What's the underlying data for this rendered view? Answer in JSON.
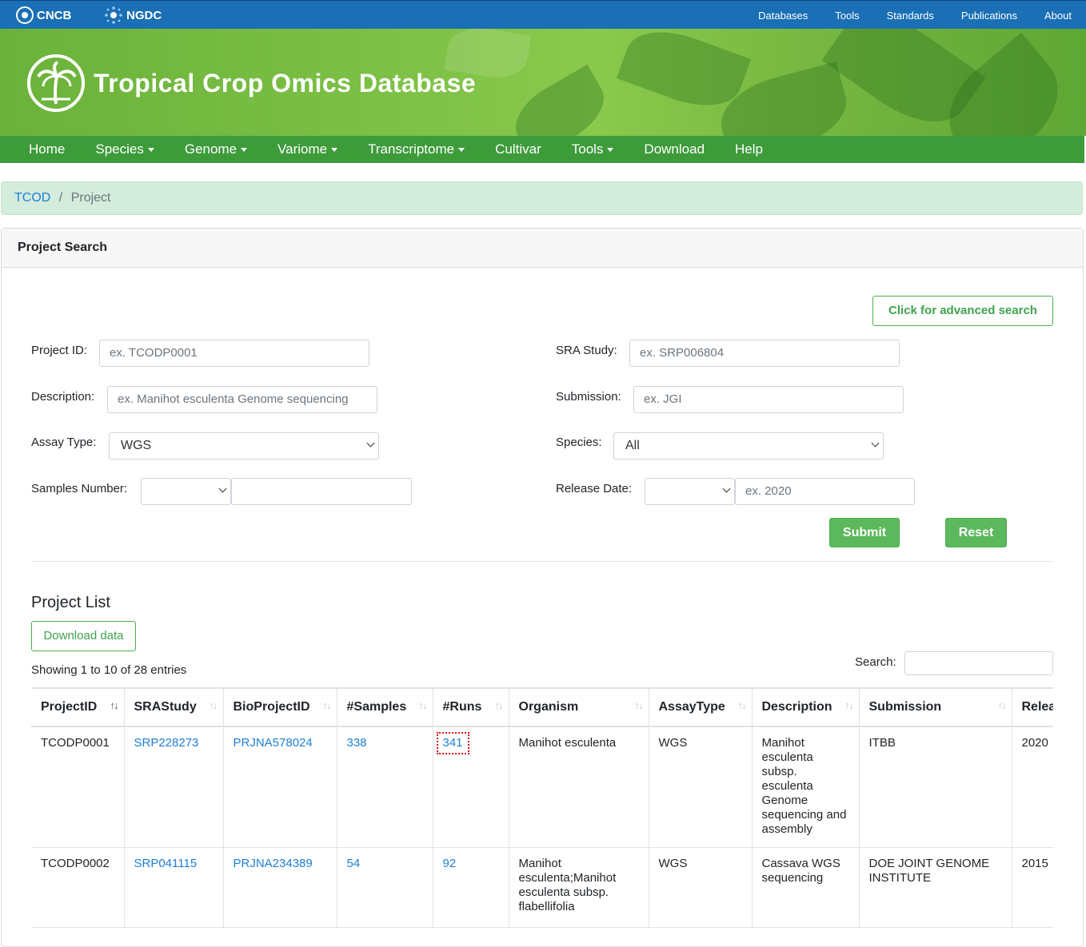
{
  "topbar": {
    "brand1": "CNCB",
    "brand2": "NGDC",
    "links": [
      "Databases",
      "Tools",
      "Standards",
      "Publications",
      "About"
    ]
  },
  "banner": {
    "title": "Tropical Crop Omics Database"
  },
  "nav": {
    "items": [
      {
        "label": "Home",
        "dropdown": false
      },
      {
        "label": "Species",
        "dropdown": true
      },
      {
        "label": "Genome",
        "dropdown": true
      },
      {
        "label": "Variome",
        "dropdown": true
      },
      {
        "label": "Transcriptome",
        "dropdown": true
      },
      {
        "label": "Cultivar",
        "dropdown": false
      },
      {
        "label": "Tools",
        "dropdown": true
      },
      {
        "label": "Download",
        "dropdown": false
      },
      {
        "label": "Help",
        "dropdown": false
      }
    ]
  },
  "breadcrumb": {
    "root": "TCOD",
    "sep": "/",
    "current": "Project"
  },
  "search": {
    "header": "Project Search",
    "advanced_button": "Click for advanced search",
    "project_id": {
      "label": "Project ID:",
      "placeholder": "ex. TCODP0001"
    },
    "description": {
      "label": "Description:",
      "placeholder": "ex. Manihot esculenta Genome sequencing"
    },
    "assay_type": {
      "label": "Assay Type:",
      "value": "WGS"
    },
    "samples_number": {
      "label": "Samples Number:",
      "value": ""
    },
    "sra_study": {
      "label": "SRA Study:",
      "placeholder": "ex. SRP006804"
    },
    "submission": {
      "label": "Submission:",
      "placeholder": "ex. JGI"
    },
    "species": {
      "label": "Species:",
      "value": "All"
    },
    "release_date": {
      "label": "Release Date:",
      "placeholder": "ex. 2020"
    },
    "submit": "Submit",
    "reset": "Reset"
  },
  "list": {
    "title": "Project List",
    "download": "Download data",
    "showing": "Showing 1 to 10 of 28 entries",
    "search_label": "Search:",
    "columns": [
      "ProjectID",
      "SRAStudy",
      "BioProjectID",
      "#Samples",
      "#Runs",
      "Organism",
      "AssayType",
      "Description",
      "Submission",
      "Relea"
    ],
    "rows": [
      {
        "projectid": "TCODP0001",
        "srastudy": "SRP228273",
        "bioprojectid": "PRJNA578024",
        "samples": "338",
        "runs": "341",
        "organism": "Manihot esculenta",
        "assaytype": "WGS",
        "description": "Manihot esculenta subsp. esculenta Genome sequencing and assembly",
        "submission": "ITBB",
        "release": "2020"
      },
      {
        "projectid": "TCODP0002",
        "srastudy": "SRP041115",
        "bioprojectid": "PRJNA234389",
        "samples": "54",
        "runs": "92",
        "organism": "Manihot esculenta;Manihot esculenta subsp. flabellifolia",
        "assaytype": "WGS",
        "description": "Cassava WGS sequencing",
        "submission": "DOE JOINT GENOME INSTITUTE",
        "release": "2015"
      }
    ]
  }
}
